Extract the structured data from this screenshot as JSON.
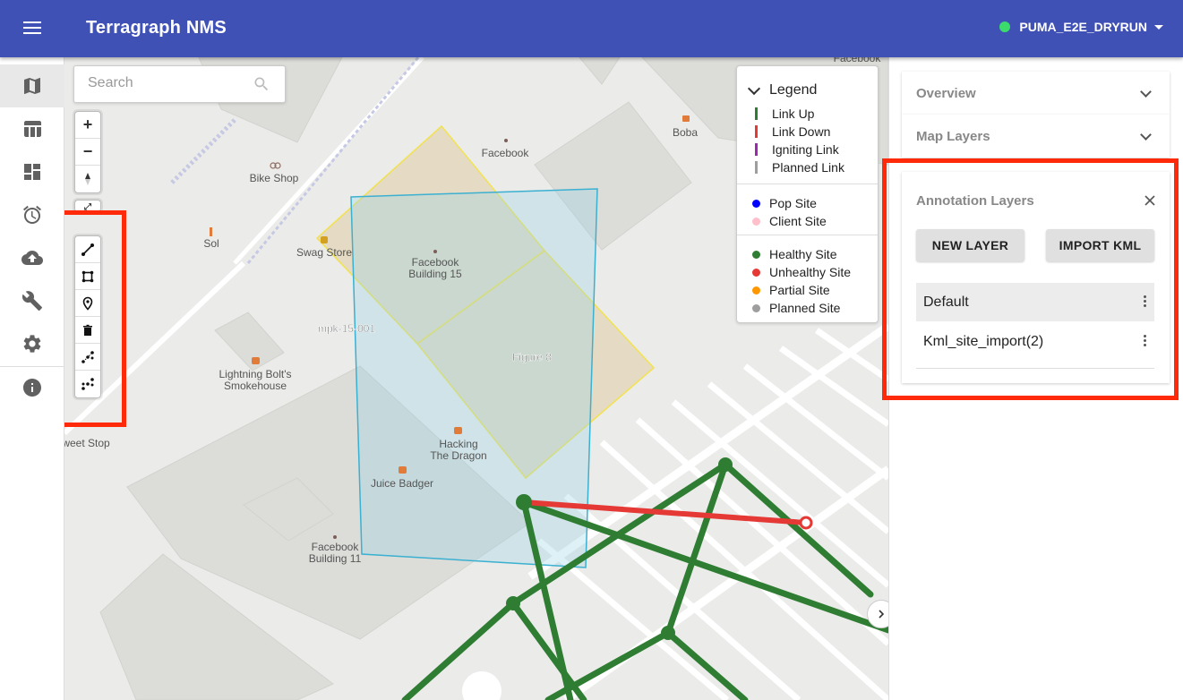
{
  "app": {
    "title": "Terragraph NMS",
    "network_name": "PUMA_E2E_DRYRUN",
    "network_status_color": "#3bdb6c",
    "brand_color": "#3f51b5"
  },
  "leftnav": {
    "items": [
      {
        "icon": "map-icon",
        "active": true
      },
      {
        "icon": "table-icon"
      },
      {
        "icon": "dashboard-icon"
      },
      {
        "icon": "alarm-icon"
      },
      {
        "icon": "cloud-upload-icon"
      },
      {
        "icon": "wrench-icon"
      },
      {
        "icon": "settings-icon"
      },
      {
        "icon": "info-icon"
      }
    ]
  },
  "map": {
    "search_placeholder": "Search",
    "labels": {
      "facebook": "Facebook",
      "boba": "Boba",
      "bike_shop": "Bike Shop",
      "sol": "Sol",
      "swag_store": "Swag Store",
      "fb15_line1": "Facebook",
      "fb15_line2": "Building 15",
      "site_name": "mpk-15-001",
      "figure8": "Figure 8",
      "lightning_line1": "Lightning Bolt's",
      "lightning_line2": "Smokehouse",
      "sweet_stop": "weet Stop",
      "hacking_line1": "Hacking",
      "hacking_line2": "The Dragon",
      "juice_badger": "Juice Badger",
      "fb11_line1": "Facebook",
      "fb11_line2": "Building 11",
      "fb_top_right": "Facebook"
    }
  },
  "legend": {
    "title": "Legend",
    "links": [
      {
        "label": "Link Up",
        "color": "#2e7d32"
      },
      {
        "label": "Link Down",
        "color": "#e53935"
      },
      {
        "label": "Igniting Link",
        "color": "#9c27b0"
      },
      {
        "label": "Planned Link",
        "color": "#9e9e9e"
      }
    ],
    "site_types": [
      {
        "label": "Pop Site",
        "color": "#0000ff"
      },
      {
        "label": "Client Site",
        "color": "#ffc0cb"
      }
    ],
    "site_health": [
      {
        "label": "Healthy Site",
        "color": "#2e7d32"
      },
      {
        "label": "Unhealthy Site",
        "color": "#e53935"
      },
      {
        "label": "Partial Site",
        "color": "#ff9800"
      },
      {
        "label": "Planned Site",
        "color": "#9e9e9e"
      }
    ]
  },
  "panel": {
    "overview_label": "Overview",
    "map_layers_label": "Map Layers",
    "annotation_layers_label": "Annotation Layers",
    "new_layer_label": "NEW LAYER",
    "import_kml_label": "IMPORT KML",
    "layers": [
      {
        "name": "Default",
        "selected": true
      },
      {
        "name": "Kml_site_import(2)",
        "selected": false
      }
    ]
  },
  "highlight_color": "#ff2a0a"
}
